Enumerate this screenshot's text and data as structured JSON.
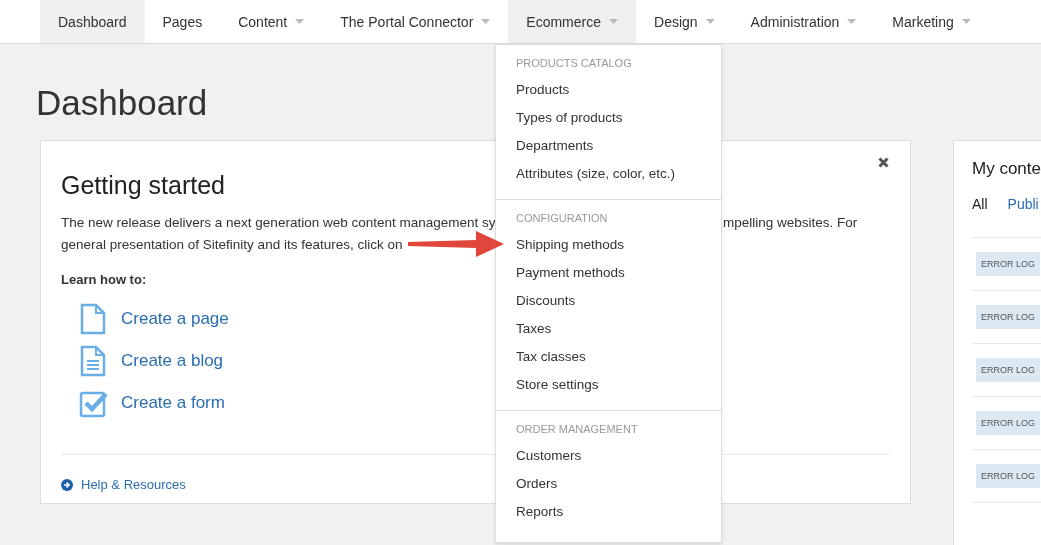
{
  "nav": [
    {
      "label": "Dashboard",
      "caret": false,
      "selected": true
    },
    {
      "label": "Pages",
      "caret": false,
      "selected": false
    },
    {
      "label": "Content",
      "caret": true,
      "selected": false
    },
    {
      "label": "The Portal Connector",
      "caret": true,
      "selected": false
    },
    {
      "label": "Ecommerce",
      "caret": true,
      "selected": true
    },
    {
      "label": "Design",
      "caret": true,
      "selected": false
    },
    {
      "label": "Administration",
      "caret": true,
      "selected": false
    },
    {
      "label": "Marketing",
      "caret": true,
      "selected": false
    }
  ],
  "dropdown": {
    "sections": [
      {
        "header": "PRODUCTS CATALOG",
        "items": [
          "Products",
          "Types of products",
          "Departments",
          "Attributes (size, color, etc.)"
        ]
      },
      {
        "header": "CONFIGURATION",
        "items": [
          "Shipping methods",
          "Payment methods",
          "Discounts",
          "Taxes",
          "Tax classes",
          "Store settings"
        ]
      },
      {
        "header": "ORDER MANAGEMENT",
        "items": [
          "Customers",
          "Orders",
          "Reports"
        ]
      }
    ]
  },
  "page_title": "Dashboard",
  "getting_started": {
    "title": "Getting started",
    "text_line_1_left": "The new release delivers a next generation web content management sy",
    "text_line_1_right": "mpelling websites. For",
    "text_line_2": "general presentation of Sitefinity and its features, click on",
    "learn_label": "Learn how to:",
    "links": [
      {
        "kind": "page",
        "label": "Create a page"
      },
      {
        "kind": "blog",
        "label": "Create a blog"
      },
      {
        "kind": "form",
        "label": "Create a form"
      }
    ],
    "help_link": "Help & Resources"
  },
  "my_content": {
    "title": "My conte",
    "tabs": [
      {
        "label": "All",
        "selected": true
      },
      {
        "label": "Publi",
        "selected": false
      }
    ],
    "rows": [
      {
        "badge": "ERROR LOG"
      },
      {
        "badge": "ERROR LOG"
      },
      {
        "badge": "ERROR LOG"
      },
      {
        "badge": "ERROR LOG"
      },
      {
        "badge": "ERROR LOG"
      }
    ]
  }
}
